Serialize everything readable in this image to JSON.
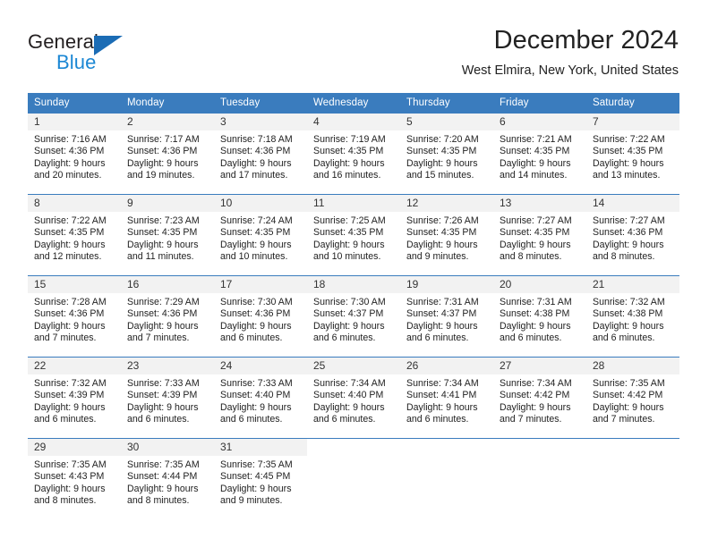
{
  "brand": {
    "name_part1": "General",
    "name_part2": "Blue",
    "logo_icon": "triangle-logo-icon"
  },
  "header": {
    "title": "December 2024",
    "location": "West Elmira, New York, United States"
  },
  "colors": {
    "header_blue": "#3a7cbe",
    "brand_dark_blue": "#1b6cb5",
    "brand_light_blue": "#1b87d4",
    "daynum_band": "#f2f2f2",
    "text": "#222222"
  },
  "weekday_headers": [
    "Sunday",
    "Monday",
    "Tuesday",
    "Wednesday",
    "Thursday",
    "Friday",
    "Saturday"
  ],
  "weeks": [
    [
      {
        "day": "1",
        "sunrise": "Sunrise: 7:16 AM",
        "sunset": "Sunset: 4:36 PM",
        "daylight_l1": "Daylight: 9 hours",
        "daylight_l2": "and 20 minutes."
      },
      {
        "day": "2",
        "sunrise": "Sunrise: 7:17 AM",
        "sunset": "Sunset: 4:36 PM",
        "daylight_l1": "Daylight: 9 hours",
        "daylight_l2": "and 19 minutes."
      },
      {
        "day": "3",
        "sunrise": "Sunrise: 7:18 AM",
        "sunset": "Sunset: 4:36 PM",
        "daylight_l1": "Daylight: 9 hours",
        "daylight_l2": "and 17 minutes."
      },
      {
        "day": "4",
        "sunrise": "Sunrise: 7:19 AM",
        "sunset": "Sunset: 4:35 PM",
        "daylight_l1": "Daylight: 9 hours",
        "daylight_l2": "and 16 minutes."
      },
      {
        "day": "5",
        "sunrise": "Sunrise: 7:20 AM",
        "sunset": "Sunset: 4:35 PM",
        "daylight_l1": "Daylight: 9 hours",
        "daylight_l2": "and 15 minutes."
      },
      {
        "day": "6",
        "sunrise": "Sunrise: 7:21 AM",
        "sunset": "Sunset: 4:35 PM",
        "daylight_l1": "Daylight: 9 hours",
        "daylight_l2": "and 14 minutes."
      },
      {
        "day": "7",
        "sunrise": "Sunrise: 7:22 AM",
        "sunset": "Sunset: 4:35 PM",
        "daylight_l1": "Daylight: 9 hours",
        "daylight_l2": "and 13 minutes."
      }
    ],
    [
      {
        "day": "8",
        "sunrise": "Sunrise: 7:22 AM",
        "sunset": "Sunset: 4:35 PM",
        "daylight_l1": "Daylight: 9 hours",
        "daylight_l2": "and 12 minutes."
      },
      {
        "day": "9",
        "sunrise": "Sunrise: 7:23 AM",
        "sunset": "Sunset: 4:35 PM",
        "daylight_l1": "Daylight: 9 hours",
        "daylight_l2": "and 11 minutes."
      },
      {
        "day": "10",
        "sunrise": "Sunrise: 7:24 AM",
        "sunset": "Sunset: 4:35 PM",
        "daylight_l1": "Daylight: 9 hours",
        "daylight_l2": "and 10 minutes."
      },
      {
        "day": "11",
        "sunrise": "Sunrise: 7:25 AM",
        "sunset": "Sunset: 4:35 PM",
        "daylight_l1": "Daylight: 9 hours",
        "daylight_l2": "and 10 minutes."
      },
      {
        "day": "12",
        "sunrise": "Sunrise: 7:26 AM",
        "sunset": "Sunset: 4:35 PM",
        "daylight_l1": "Daylight: 9 hours",
        "daylight_l2": "and 9 minutes."
      },
      {
        "day": "13",
        "sunrise": "Sunrise: 7:27 AM",
        "sunset": "Sunset: 4:35 PM",
        "daylight_l1": "Daylight: 9 hours",
        "daylight_l2": "and 8 minutes."
      },
      {
        "day": "14",
        "sunrise": "Sunrise: 7:27 AM",
        "sunset": "Sunset: 4:36 PM",
        "daylight_l1": "Daylight: 9 hours",
        "daylight_l2": "and 8 minutes."
      }
    ],
    [
      {
        "day": "15",
        "sunrise": "Sunrise: 7:28 AM",
        "sunset": "Sunset: 4:36 PM",
        "daylight_l1": "Daylight: 9 hours",
        "daylight_l2": "and 7 minutes."
      },
      {
        "day": "16",
        "sunrise": "Sunrise: 7:29 AM",
        "sunset": "Sunset: 4:36 PM",
        "daylight_l1": "Daylight: 9 hours",
        "daylight_l2": "and 7 minutes."
      },
      {
        "day": "17",
        "sunrise": "Sunrise: 7:30 AM",
        "sunset": "Sunset: 4:36 PM",
        "daylight_l1": "Daylight: 9 hours",
        "daylight_l2": "and 6 minutes."
      },
      {
        "day": "18",
        "sunrise": "Sunrise: 7:30 AM",
        "sunset": "Sunset: 4:37 PM",
        "daylight_l1": "Daylight: 9 hours",
        "daylight_l2": "and 6 minutes."
      },
      {
        "day": "19",
        "sunrise": "Sunrise: 7:31 AM",
        "sunset": "Sunset: 4:37 PM",
        "daylight_l1": "Daylight: 9 hours",
        "daylight_l2": "and 6 minutes."
      },
      {
        "day": "20",
        "sunrise": "Sunrise: 7:31 AM",
        "sunset": "Sunset: 4:38 PM",
        "daylight_l1": "Daylight: 9 hours",
        "daylight_l2": "and 6 minutes."
      },
      {
        "day": "21",
        "sunrise": "Sunrise: 7:32 AM",
        "sunset": "Sunset: 4:38 PM",
        "daylight_l1": "Daylight: 9 hours",
        "daylight_l2": "and 6 minutes."
      }
    ],
    [
      {
        "day": "22",
        "sunrise": "Sunrise: 7:32 AM",
        "sunset": "Sunset: 4:39 PM",
        "daylight_l1": "Daylight: 9 hours",
        "daylight_l2": "and 6 minutes."
      },
      {
        "day": "23",
        "sunrise": "Sunrise: 7:33 AM",
        "sunset": "Sunset: 4:39 PM",
        "daylight_l1": "Daylight: 9 hours",
        "daylight_l2": "and 6 minutes."
      },
      {
        "day": "24",
        "sunrise": "Sunrise: 7:33 AM",
        "sunset": "Sunset: 4:40 PM",
        "daylight_l1": "Daylight: 9 hours",
        "daylight_l2": "and 6 minutes."
      },
      {
        "day": "25",
        "sunrise": "Sunrise: 7:34 AM",
        "sunset": "Sunset: 4:40 PM",
        "daylight_l1": "Daylight: 9 hours",
        "daylight_l2": "and 6 minutes."
      },
      {
        "day": "26",
        "sunrise": "Sunrise: 7:34 AM",
        "sunset": "Sunset: 4:41 PM",
        "daylight_l1": "Daylight: 9 hours",
        "daylight_l2": "and 6 minutes."
      },
      {
        "day": "27",
        "sunrise": "Sunrise: 7:34 AM",
        "sunset": "Sunset: 4:42 PM",
        "daylight_l1": "Daylight: 9 hours",
        "daylight_l2": "and 7 minutes."
      },
      {
        "day": "28",
        "sunrise": "Sunrise: 7:35 AM",
        "sunset": "Sunset: 4:42 PM",
        "daylight_l1": "Daylight: 9 hours",
        "daylight_l2": "and 7 minutes."
      }
    ],
    [
      {
        "day": "29",
        "sunrise": "Sunrise: 7:35 AM",
        "sunset": "Sunset: 4:43 PM",
        "daylight_l1": "Daylight: 9 hours",
        "daylight_l2": "and 8 minutes."
      },
      {
        "day": "30",
        "sunrise": "Sunrise: 7:35 AM",
        "sunset": "Sunset: 4:44 PM",
        "daylight_l1": "Daylight: 9 hours",
        "daylight_l2": "and 8 minutes."
      },
      {
        "day": "31",
        "sunrise": "Sunrise: 7:35 AM",
        "sunset": "Sunset: 4:45 PM",
        "daylight_l1": "Daylight: 9 hours",
        "daylight_l2": "and 9 minutes."
      },
      {
        "day": "",
        "sunrise": "",
        "sunset": "",
        "daylight_l1": "",
        "daylight_l2": ""
      },
      {
        "day": "",
        "sunrise": "",
        "sunset": "",
        "daylight_l1": "",
        "daylight_l2": ""
      },
      {
        "day": "",
        "sunrise": "",
        "sunset": "",
        "daylight_l1": "",
        "daylight_l2": ""
      },
      {
        "day": "",
        "sunrise": "",
        "sunset": "",
        "daylight_l1": "",
        "daylight_l2": ""
      }
    ]
  ]
}
